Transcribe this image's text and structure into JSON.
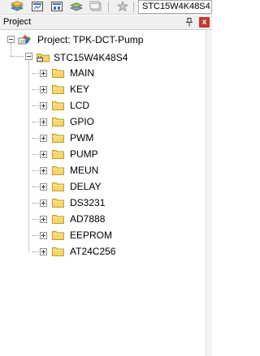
{
  "toolbar": {
    "icons": [
      "stack-icon",
      "translate-icon",
      "build-icon",
      "rebuild-icon",
      "batch-build-icon",
      "stop-build-icon"
    ],
    "device_selector_value": "STC15W4K48S4"
  },
  "panel": {
    "title": "Project",
    "pin_icon": "pin-icon",
    "close_glyph": "x"
  },
  "tree": {
    "project_label": "Project: TPK-DCT-Pump",
    "target_label": "STC15W4K48S4",
    "groups": [
      {
        "label": "MAIN",
        "expanded": false
      },
      {
        "label": "KEY",
        "expanded": false
      },
      {
        "label": "LCD",
        "expanded": false
      },
      {
        "label": "GPIO",
        "expanded": false
      },
      {
        "label": "PWM",
        "expanded": false
      },
      {
        "label": "PUMP",
        "expanded": false
      },
      {
        "label": "MEUN",
        "expanded": false
      },
      {
        "label": "DELAY",
        "expanded": false
      },
      {
        "label": "DS3231",
        "expanded": false
      },
      {
        "label": "AD7888",
        "expanded": false
      },
      {
        "label": "EEPROM",
        "expanded": false
      },
      {
        "label": "AT24C256",
        "expanded": false
      }
    ]
  },
  "colors": {
    "folder_fill": "#f5d56e",
    "folder_edge": "#c49a22",
    "close_button": "#c8382c"
  }
}
